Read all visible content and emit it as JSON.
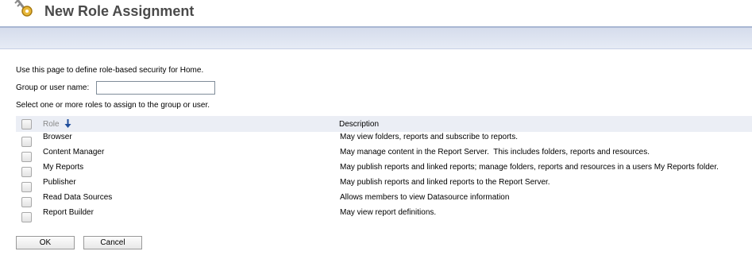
{
  "header": {
    "title": "New Role Assignment",
    "icon": "key-icon"
  },
  "form": {
    "intro_text": "Use this page to define role-based security for Home.",
    "user_label": "Group or user name:",
    "user_value": "",
    "select_text": "Select one or more roles to assign to the group or user."
  },
  "table": {
    "role_header": "Role",
    "sort_icon": "sort-down-arrow-icon",
    "description_header": "Description",
    "rows": [
      {
        "role": "Browser",
        "description": "May view folders, reports and subscribe to reports.",
        "checked": false
      },
      {
        "role": "Content Manager",
        "description": "May manage content in the Report Server.  This includes folders, reports and resources.",
        "checked": false
      },
      {
        "role": "My Reports",
        "description": "May publish reports and linked reports; manage folders, reports and resources in a users My Reports folder.",
        "checked": false
      },
      {
        "role": "Publisher",
        "description": "May publish reports and linked reports to the Report Server.",
        "checked": false
      },
      {
        "role": "Read Data Sources",
        "description": "Allows members to view Datasource information",
        "checked": false
      },
      {
        "role": "Report Builder",
        "description": "May view report definitions.",
        "checked": false
      }
    ]
  },
  "buttons": {
    "ok": "OK",
    "cancel": "Cancel"
  },
  "colors": {
    "title": "#4a4a4a",
    "bar": "#dde3f0",
    "table_header": "#ebeef5",
    "sort_arrow": "#1f4e9c"
  }
}
